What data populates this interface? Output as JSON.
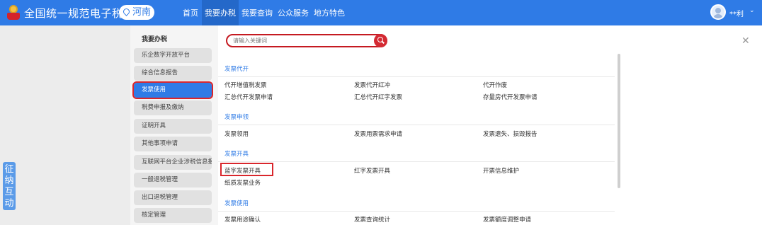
{
  "header": {
    "site_title": "全国统一规范电子税务局",
    "region": "河南",
    "nav": [
      "首页",
      "我要办税",
      "我要查询",
      "公众服务",
      "地方特色"
    ],
    "active_nav": "我要办税",
    "username": "**利",
    "brand_color": "#2f7be6"
  },
  "float_button": {
    "chars": [
      "征",
      "纳",
      "互",
      "动"
    ]
  },
  "sidebar": {
    "title": "我要办税",
    "items": [
      {
        "label": "乐企数字开放平台"
      },
      {
        "label": "综合信息报告"
      },
      {
        "label": "发票使用",
        "active": true
      },
      {
        "label": "税费申报及缴纳"
      },
      {
        "label": "证明开具"
      },
      {
        "label": "其他事项申请"
      },
      {
        "label": "互联网平台企业涉税信息报送"
      },
      {
        "label": "一般退税管理"
      },
      {
        "label": "出口退税管理"
      },
      {
        "label": "核定管理"
      }
    ]
  },
  "search": {
    "placeholder": "请输入关键词"
  },
  "sections": [
    {
      "title": "发票代开",
      "links": [
        [
          "代开增值税发票",
          "发票代开红冲",
          "代开作废"
        ],
        [
          "汇总代开发票申请",
          "汇总代开红字发票",
          "存量房代开发票申请"
        ]
      ]
    },
    {
      "title": "发票申领",
      "links": [
        [
          "发票领用",
          "发票用票需求申请",
          "发票遗失、损毁报告"
        ]
      ]
    },
    {
      "title": "发票开具",
      "links": [
        [
          "蓝字发票开具",
          "红字发票开具",
          "开票信息维护"
        ],
        [
          "纸质发票业务"
        ]
      ]
    },
    {
      "title": "发票使用",
      "links": [
        [
          "发票用途确认",
          "发票查询统计",
          "发票额度调整申请"
        ]
      ]
    }
  ],
  "highlight_color": "#d9262c"
}
